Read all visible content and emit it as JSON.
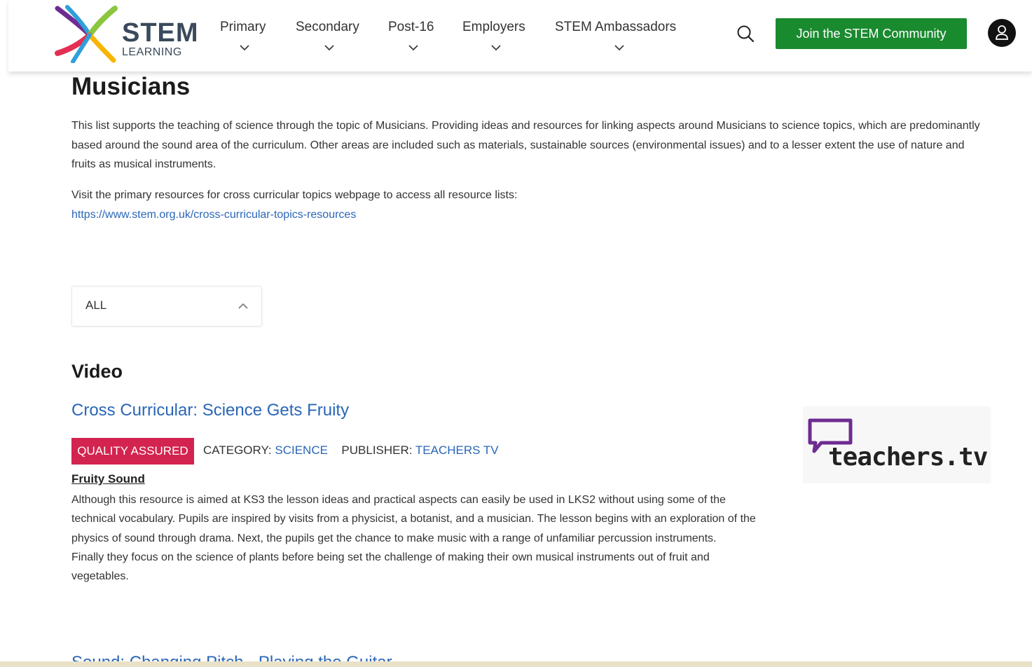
{
  "header": {
    "logo": {
      "word": "STEM",
      "sub": "LEARNING"
    },
    "nav": [
      "Primary",
      "Secondary",
      "Post-16",
      "Employers",
      "STEM Ambassadors"
    ],
    "search_icon": "search-icon",
    "join_label": "Join the STEM Community",
    "avatar_icon": "user-icon"
  },
  "main": {
    "title": "Musicians",
    "intro": "This list supports the teaching of science through the topic of Musicians. Providing ideas and resources for linking aspects around Musicians  to science topics, which are predominantly based around the sound area of the curriculum. Other areas are included such as materials, sustainable sources (environmental issues) and to a lesser extent the use of nature and fruits as musical instruments.",
    "visit_text": "Visit the primary resources for cross curricular topics webpage to access all resource lists:",
    "visit_link": "https://www.stem.org.uk/cross-curricular-topics-resources",
    "filter": {
      "value": "ALL"
    },
    "section_heading": "Video",
    "resource": {
      "title": "Cross Curricular: Science Gets Fruity",
      "badge": "QUALITY ASSURED",
      "category_label": "CATEGORY:",
      "category_value": "SCIENCE",
      "publisher_label": "PUBLISHER:",
      "publisher_value": "TEACHERS TV",
      "subheading": "Fruity Sound",
      "desc1": "Although this resource is aimed at KS3 the lesson ideas and practical aspects can easily be used in LKS2 without using some of the technical vocabulary. Pupils are inspired by visits from a physicist, a botanist, and a musician. The lesson begins with an exploration of the physics of sound through drama. Next, the pupils get the chance to make music with a range of unfamiliar percussion instruments.",
      "desc2": "Finally they focus on the science of plants before being set the challenge of making their own musical instruments out of fruit and vegetables.",
      "thumb_text": "teachers.tv"
    },
    "next_title": "Sound: Changing Pitch - Playing the Guitar"
  },
  "colors": {
    "join_green": "#1a8a2f",
    "badge_red": "#d3234f",
    "link_blue": "#2a66b8",
    "thumb_purple": "#6d2c91"
  }
}
